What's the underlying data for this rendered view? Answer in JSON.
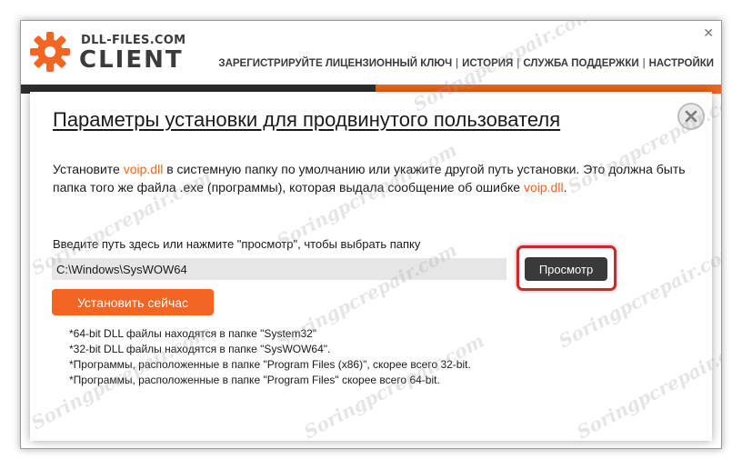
{
  "app": {
    "brand_top": "DLL-FILES.COM",
    "brand_main": "CLIENT",
    "window_close": "✕"
  },
  "nav": {
    "items": [
      "ЗАРЕГИСТРИРУЙТЕ ЛИЦЕНЗИОННЫЙ КЛЮЧ",
      "ИСТОРИЯ",
      "СЛУЖБА ПОДДЕРЖКИ",
      "НАСТРОЙКИ"
    ],
    "separator": "|"
  },
  "dialog": {
    "title": "Параметры установки для продвинутого пользователя",
    "desc": {
      "p1_before": "Установите ",
      "dll_name": "voip.dll",
      "p1_after": " в системную папку по умолчанию или укажите другой путь установки. Это должна быть папка того же файла .exe (программы), которая выдала сообщение об ошибке ",
      "dll_name_2": "voip.dll",
      "end": "."
    },
    "path_label": "Введите путь здесь или нажмите \"просмотр\", чтобы выбрать папку",
    "path_value": "C:\\Windows\\SysWOW64",
    "browse_label": "Просмотр",
    "install_label": "Установить сейчас",
    "notes": [
      "*64-bit DLL файлы находятся в папке \"System32\"",
      "*32-bit DLL файлы находятся в папке \"SysWOW64\".",
      "*Программы, расположенные в папке \"Program Files (x86)\", скорее всего 32-bit.",
      "*Программы, расположенные в папке \"Program Files\" скорее всего 64-bit."
    ]
  },
  "watermark": "Soringpcrepair.com",
  "colors": {
    "accent": "#f26522",
    "dark": "#3a3a3a",
    "highlight": "#d32626"
  }
}
